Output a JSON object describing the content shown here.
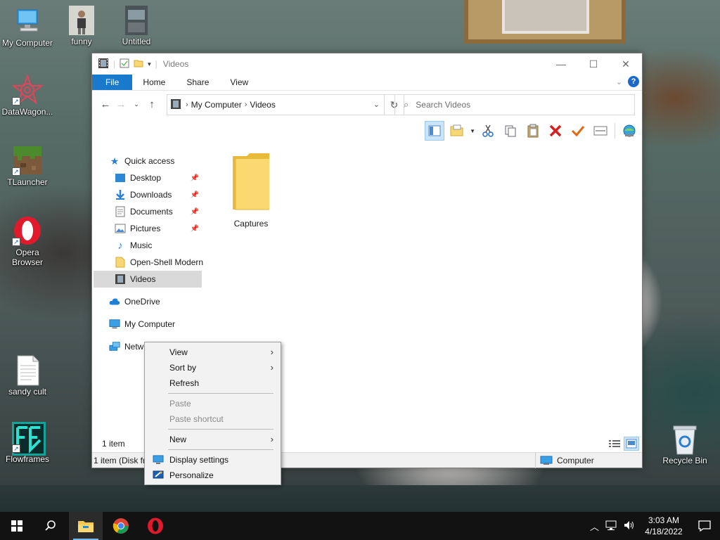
{
  "desktop_icons": [
    {
      "label": "My Computer"
    },
    {
      "label": "funny"
    },
    {
      "label": "Untitled"
    },
    {
      "label": "DataWagon..."
    },
    {
      "label": "TLauncher"
    },
    {
      "label": "Opera Browser"
    },
    {
      "label": "sandy cult"
    },
    {
      "label": "Flowframes"
    },
    {
      "label": "Recycle Bin"
    }
  ],
  "window": {
    "title": "Videos",
    "tabs": [
      "File",
      "Home",
      "Share",
      "View"
    ],
    "address": {
      "crumbs": [
        "My Computer",
        "Videos"
      ]
    },
    "search_placeholder": "Search Videos",
    "nav": {
      "quick_access": "Quick access",
      "items": [
        {
          "label": "Desktop",
          "pinned": true
        },
        {
          "label": "Downloads",
          "pinned": true
        },
        {
          "label": "Documents",
          "pinned": true
        },
        {
          "label": "Pictures",
          "pinned": true
        },
        {
          "label": "Music",
          "pinned": false
        },
        {
          "label": "Open-Shell Modern",
          "pinned": false
        },
        {
          "label": "Videos",
          "pinned": false
        }
      ],
      "onedrive": "OneDrive",
      "my_computer": "My Computer",
      "network": "Netwo"
    },
    "content": {
      "items": [
        {
          "name": "Captures",
          "type": "folder"
        }
      ]
    },
    "status": {
      "item_count": "1 item",
      "details": "1 item (Disk fr",
      "location": "Computer"
    }
  },
  "context_menu": {
    "items": [
      {
        "label": "View",
        "submenu": true,
        "disabled": false
      },
      {
        "label": "Sort by",
        "submenu": true,
        "disabled": false
      },
      {
        "label": "Refresh",
        "submenu": false,
        "disabled": false
      },
      {
        "label": "Paste",
        "submenu": false,
        "disabled": true
      },
      {
        "label": "Paste shortcut",
        "submenu": false,
        "disabled": true
      },
      {
        "label": "New",
        "submenu": true,
        "disabled": false
      },
      {
        "label": "Display settings",
        "submenu": false,
        "disabled": false,
        "icon": "display-icon"
      },
      {
        "label": "Personalize",
        "submenu": false,
        "disabled": false,
        "icon": "personalize-icon"
      }
    ]
  },
  "taskbar": {
    "clock": {
      "time": "3:03 AM",
      "date": "4/18/2022"
    },
    "pinned": [
      "start-icon",
      "search-icon",
      "file-explorer-icon",
      "chrome-icon",
      "opera-icon"
    ]
  },
  "colors": {
    "accent": "#1979ca",
    "folder": "#f8d775",
    "selection": "#cce4f7"
  }
}
